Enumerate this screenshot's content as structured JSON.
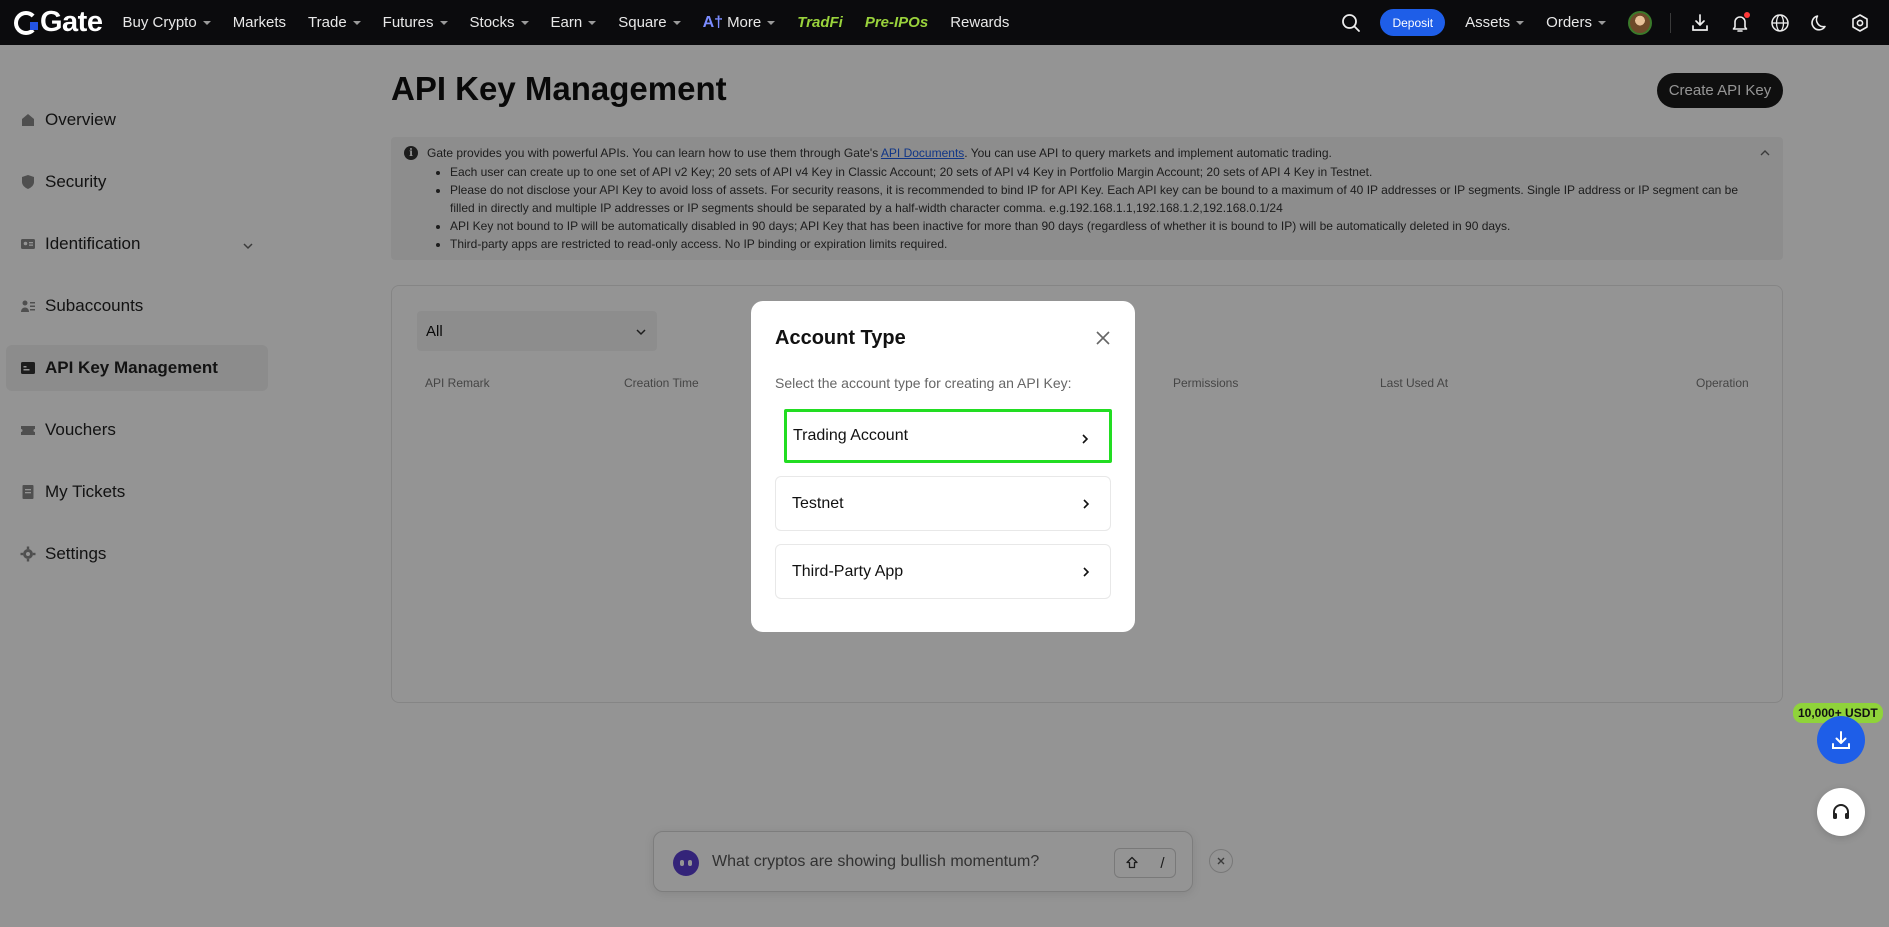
{
  "brand": {
    "name": "Gate"
  },
  "nav": {
    "items": [
      {
        "label": "Buy Crypto",
        "caret": true
      },
      {
        "label": "Markets",
        "caret": false
      },
      {
        "label": "Trade",
        "caret": true
      },
      {
        "label": "Futures",
        "caret": true
      },
      {
        "label": "Stocks",
        "caret": true
      },
      {
        "label": "Earn",
        "caret": true
      },
      {
        "label": "Square",
        "caret": true
      }
    ],
    "more_label": "More",
    "tradfi_label": "TradFi",
    "preipo_label": "Pre-IPOs",
    "rewards_label": "Rewards",
    "deposit_label": "Deposit",
    "assets_label": "Assets",
    "orders_label": "Orders"
  },
  "sidebar": {
    "items": [
      {
        "label": "Overview",
        "icon": "home-icon"
      },
      {
        "label": "Security",
        "icon": "shield-icon"
      },
      {
        "label": "Identification",
        "icon": "id-card-icon"
      },
      {
        "label": "Subaccounts",
        "icon": "users-icon"
      },
      {
        "label": "API Key Management",
        "icon": "api-icon"
      },
      {
        "label": "Vouchers",
        "icon": "ticket-icon"
      },
      {
        "label": "My Tickets",
        "icon": "document-icon"
      },
      {
        "label": "Settings",
        "icon": "gear-icon"
      }
    ],
    "active_index": 4
  },
  "page": {
    "title": "API Key Management",
    "create_button": "Create API Key"
  },
  "notice": {
    "intro_before": "Gate provides you with powerful APIs. You can learn how to use them through Gate's",
    "link": "API Documents",
    "intro_after": ". You can use API to query markets and implement automatic trading.",
    "bullets": [
      "Each user can create up to one set of API v2 Key; 20 sets of API v4 Key in Classic Account; 20 sets of API v4 Key in Portfolio Margin Account; 20 sets of API 4 Key in Testnet.",
      "Please do not disclose your API Key to avoid loss of assets. For security reasons, it is recommended to bind IP for API Key. Each API key can be bound to a maximum of 40 IP addresses or IP segments. Single IP address or IP segment can be filled in directly and multiple IP addresses or IP segments should be separated by a half-width character comma. e.g.192.168.1.1,192.168.1.2,192.168.0.1/24",
      "API Key not bound to IP will be automatically disabled in 90 days; API Key that has been inactive for more than 90 days (regardless of whether it is bound to IP) will be automatically deleted in 90 days.",
      "Third-party apps are restricted to read-only access. No IP binding or expiration limits required."
    ]
  },
  "table": {
    "filter_value": "All",
    "columns": [
      "API Remark",
      "Creation Time",
      "Permissions",
      "Last Used At",
      "Operation"
    ]
  },
  "modal": {
    "title": "Account Type",
    "description": "Select the account type for creating an API Key:",
    "options": [
      "Trading Account",
      "Testnet",
      "Third-Party App"
    ],
    "highlighted_index": 0
  },
  "promo": {
    "label": "10,000+ USDT"
  },
  "ai_bar": {
    "placeholder": "What cryptos are showing bullish momentum?",
    "shortcut_key": "/"
  },
  "colors": {
    "accent": "#1e5ee8",
    "promo": "#8fd33a",
    "highlight": "#22dd22",
    "nav_bg": "#0b0b0d"
  }
}
